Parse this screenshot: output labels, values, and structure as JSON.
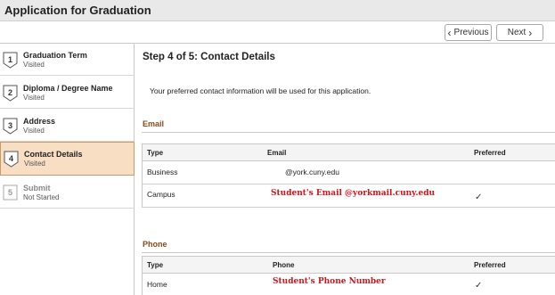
{
  "app": {
    "title": "Application for Graduation"
  },
  "nav": {
    "previous_label": "Previous",
    "next_label": "Next"
  },
  "steps": [
    {
      "number": "1",
      "title": "Graduation Term",
      "status": "Visited"
    },
    {
      "number": "2",
      "title": "Diploma / Degree Name",
      "status": "Visited"
    },
    {
      "number": "3",
      "title": "Address",
      "status": "Visited"
    },
    {
      "number": "4",
      "title": "Contact Details",
      "status": "Visited"
    },
    {
      "number": "5",
      "title": "Submit",
      "status": "Not Started"
    }
  ],
  "main": {
    "heading": "Step 4 of 5: Contact Details",
    "note": "Your preferred contact information will be used for this application."
  },
  "email": {
    "section_title": "Email",
    "columns": {
      "type": "Type",
      "value": "Email",
      "preferred": "Preferred"
    },
    "rows": [
      {
        "type": "Business",
        "value": "@york.cuny.edu",
        "annotation": "",
        "preferred": ""
      },
      {
        "type": "Campus",
        "value": "",
        "annotation": "Student's Email @yorkmail.cuny.edu",
        "preferred": "✓"
      }
    ]
  },
  "phone": {
    "section_title": "Phone",
    "columns": {
      "type": "Type",
      "value": "Phone",
      "preferred": "Preferred"
    },
    "rows": [
      {
        "type": "Home",
        "annotation": "Student's Phone Number",
        "preferred": "✓"
      }
    ]
  },
  "colors": {
    "accent_section": "#8a4a1e",
    "active_step_bg": "#f8dfc3",
    "annotation_red": "#d0161c"
  }
}
